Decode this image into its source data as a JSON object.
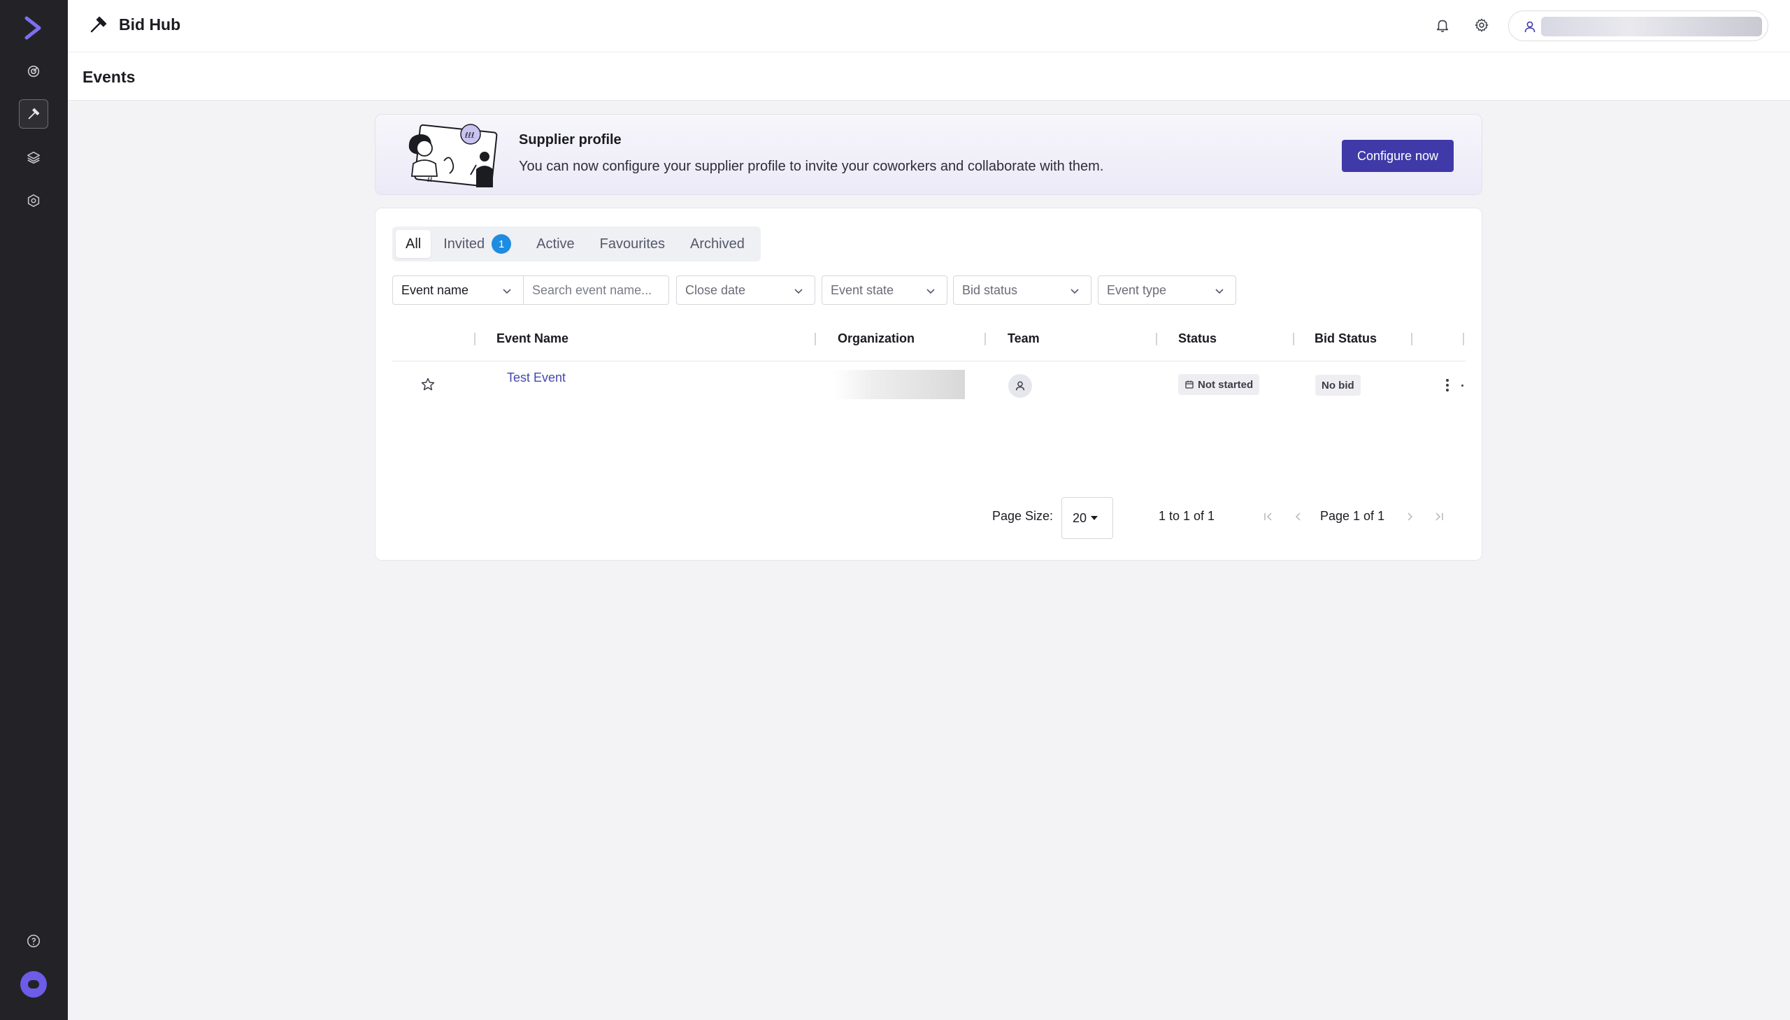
{
  "app": {
    "title": "Bid Hub"
  },
  "page": {
    "title": "Events"
  },
  "banner": {
    "title": "Supplier profile",
    "text": "You can now configure your supplier profile to invite your coworkers and collaborate with them.",
    "button": "Configure now"
  },
  "tabs": [
    {
      "label": "All",
      "active": true
    },
    {
      "label": "Invited",
      "badge": "1"
    },
    {
      "label": "Active"
    },
    {
      "label": "Favourites"
    },
    {
      "label": "Archived"
    }
  ],
  "filters": {
    "field_select": "Event name",
    "search_placeholder": "Search event name...",
    "close_date": "Close date",
    "event_state": "Event state",
    "bid_status": "Bid status",
    "event_type": "Event type"
  },
  "table": {
    "columns": [
      "Event Name",
      "Organization",
      "Team",
      "Status",
      "Bid Status"
    ],
    "rows": [
      {
        "event_name": "Test Event",
        "status": "Not started",
        "bid_status": "No bid"
      }
    ]
  },
  "pagination": {
    "page_size_label": "Page Size:",
    "page_size": "20",
    "range": "1 to 1 of 1",
    "page_text": "Page 1 of 1"
  },
  "colors": {
    "rail": "#232327",
    "accent": "#3f3aa8",
    "link": "#4646b0",
    "badge": "#1e8ce0",
    "logo": "#6c5ce7"
  },
  "icons": {
    "rail": [
      "logo-chevron-icon",
      "analytics-icon",
      "gavel-icon",
      "layers-icon",
      "integrations-icon",
      "help-icon",
      "chat-icon"
    ],
    "header": [
      "gavel-icon",
      "bell-icon",
      "gear-icon",
      "user-icon"
    ]
  }
}
